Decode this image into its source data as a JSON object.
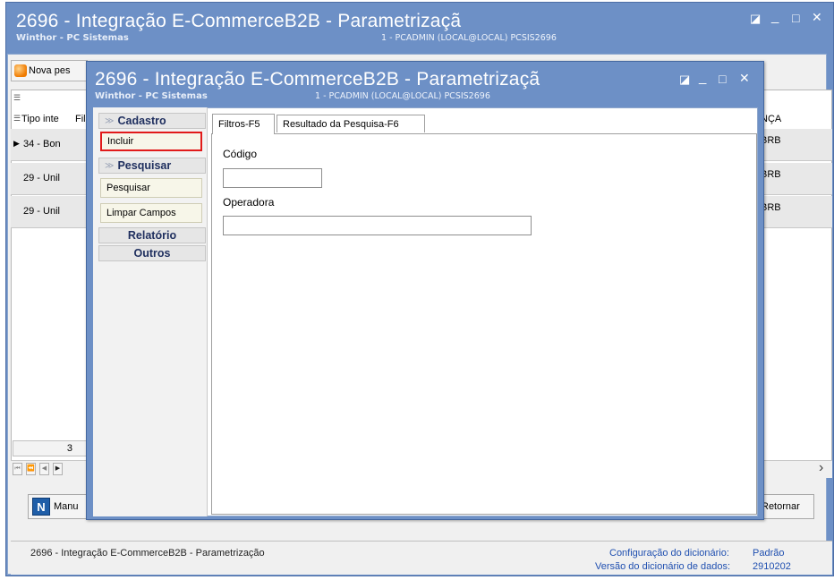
{
  "outer_window": {
    "title": "2696 - Integração E-CommerceB2B - Parametrizaçã",
    "subtitle": "Winthor - PC Sistemas",
    "session": "1 - PCADMIN (LOCAL@LOCAL)  PCSIS2696",
    "controls": {
      "restore": "◪",
      "minimize": "_",
      "maximize": "□",
      "close": "✕"
    }
  },
  "toolbar": {
    "new_search_label": "Nova pes"
  },
  "grid": {
    "col1_header": "Tipo inte",
    "col2_header": "Fil",
    "right_header": "NÇA",
    "rows": [
      {
        "col1": "34 - Bon",
        "right": "BRB"
      },
      {
        "col1": "29 - Unil",
        "right": "BRB"
      },
      {
        "col1": "29 - Unil",
        "right": "BRB"
      }
    ],
    "record_count": "3",
    "nav_first": "⏮",
    "nav_prev_page": "⏪",
    "nav_prev": "◀",
    "nav_next": "▶",
    "scroll_right": "›"
  },
  "bottom_buttons": {
    "manual_label": "Manu",
    "manual_icon": "N",
    "return_label": "Retornar"
  },
  "status_bar": {
    "left_text": "2696 - Integração E-CommerceB2B - Parametrização",
    "dict_config_label": "Configuração do dicionário:",
    "dict_config_value": "Padrão",
    "dict_version_label": "Versão do dicionário de dados:",
    "dict_version_value": "2910202"
  },
  "inner_window": {
    "title": "2696 - Integração E-CommerceB2B - Parametrizaçã",
    "subtitle": "Winthor - PC Sistemas",
    "session": "1 - PCADMIN (LOCAL@LOCAL)  PCSIS2696",
    "controls": {
      "restore": "◪",
      "minimize": "_",
      "maximize": "□",
      "close": "✕"
    }
  },
  "side_menu": {
    "cadastro": {
      "label": "Cadastro",
      "items": [
        "Incluir"
      ]
    },
    "pesquisar": {
      "label": "Pesquisar",
      "items": [
        "Pesquisar",
        "Limpar Campos"
      ]
    },
    "relatorio": {
      "label": "Relatório"
    },
    "outros": {
      "label": "Outros"
    },
    "chevron": "≫"
  },
  "tabs": [
    {
      "label": "Filtros-F5",
      "active": true
    },
    {
      "label": "Resultado da Pesquisa-F6",
      "active": false
    }
  ],
  "form": {
    "codigo_label": "Código",
    "codigo_value": "",
    "operadora_label": "Operadora",
    "operadora_value": ""
  },
  "colors": {
    "titlebar": "#6d90c6",
    "highlight_border": "#e11a1a",
    "menu_header_text": "#1e2e5e",
    "link_blue": "#1f4fb0"
  }
}
